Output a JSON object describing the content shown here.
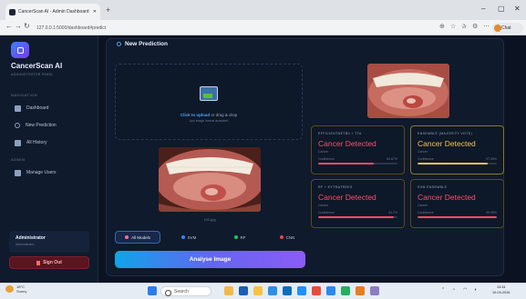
{
  "browser": {
    "tab_title": "CancerScan AI - Admin Dashboard",
    "new_tab": "+",
    "url": "127.0.0.1:5000/dashboard#predict",
    "profile": "Chat"
  },
  "sidebar": {
    "brand": "CancerScan AI",
    "subtitle": "ADMINISTRATOR PANEL",
    "nav_label": "NAVIGATION",
    "items": [
      {
        "label": "Dashboard",
        "icon": "chart-icon"
      },
      {
        "label": "New Prediction",
        "icon": "search-icon"
      },
      {
        "label": "All History",
        "icon": "list-icon"
      }
    ],
    "admin_label": "ADMIN",
    "admin_items": [
      {
        "label": "Manage Users",
        "icon": "users-icon"
      }
    ],
    "user_name": "Administrator",
    "user_role": "Administrator",
    "sign_out": "Sign Out"
  },
  "main": {
    "title": "New Prediction",
    "upload_link": "Click to upload",
    "upload_text": "or drag & drop",
    "upload_sub": "Any image format accepted",
    "filename": "192.jpg",
    "model_tabs": [
      {
        "label": "All Models",
        "color": "#ff6b9a",
        "active": true
      },
      {
        "label": "SVM",
        "color": "#3b82f6",
        "active": false
      },
      {
        "label": "RF",
        "color": "#22c55e",
        "active": false
      },
      {
        "label": "CNN",
        "color": "#ef4444",
        "active": false
      }
    ],
    "analyze_button": "Analyse Image"
  },
  "results": [
    {
      "title": "EFFICIENTNETB0 + TTA",
      "result": "Cancer Detected",
      "sub": "Cancer",
      "conf_label": "Confidence",
      "conf_value": "69.67%",
      "confidence": 0.7,
      "bar_color": "#ff4d6d",
      "ensemble": false
    },
    {
      "title": "ENSEMBLE (MAJORITY VOTE)",
      "result": "Cancer Detected",
      "sub": "Cancer",
      "conf_label": "Confidence",
      "conf_value": "97.33%",
      "confidence": 0.88,
      "bar_color": "#f5c542",
      "ensemble": true
    },
    {
      "title": "RF + EXTRATREES",
      "result": "Cancer Detected",
      "sub": "Cancer",
      "conf_label": "Confidence",
      "conf_value": "94.7%",
      "confidence": 0.95,
      "bar_color": "#ff4d6d",
      "ensemble": false
    },
    {
      "title": "SVM ENSEMBLE",
      "result": "Cancer Detected",
      "sub": "Cancer",
      "conf_label": "Confidence",
      "conf_value": "99.99%",
      "confidence": 1.0,
      "bar_color": "#ff4d6d",
      "ensemble": false
    }
  ],
  "taskbar": {
    "temp": "18°C",
    "weather": "Sunny",
    "search": "Search",
    "time": "13:34",
    "date": "10-04-2026"
  }
}
